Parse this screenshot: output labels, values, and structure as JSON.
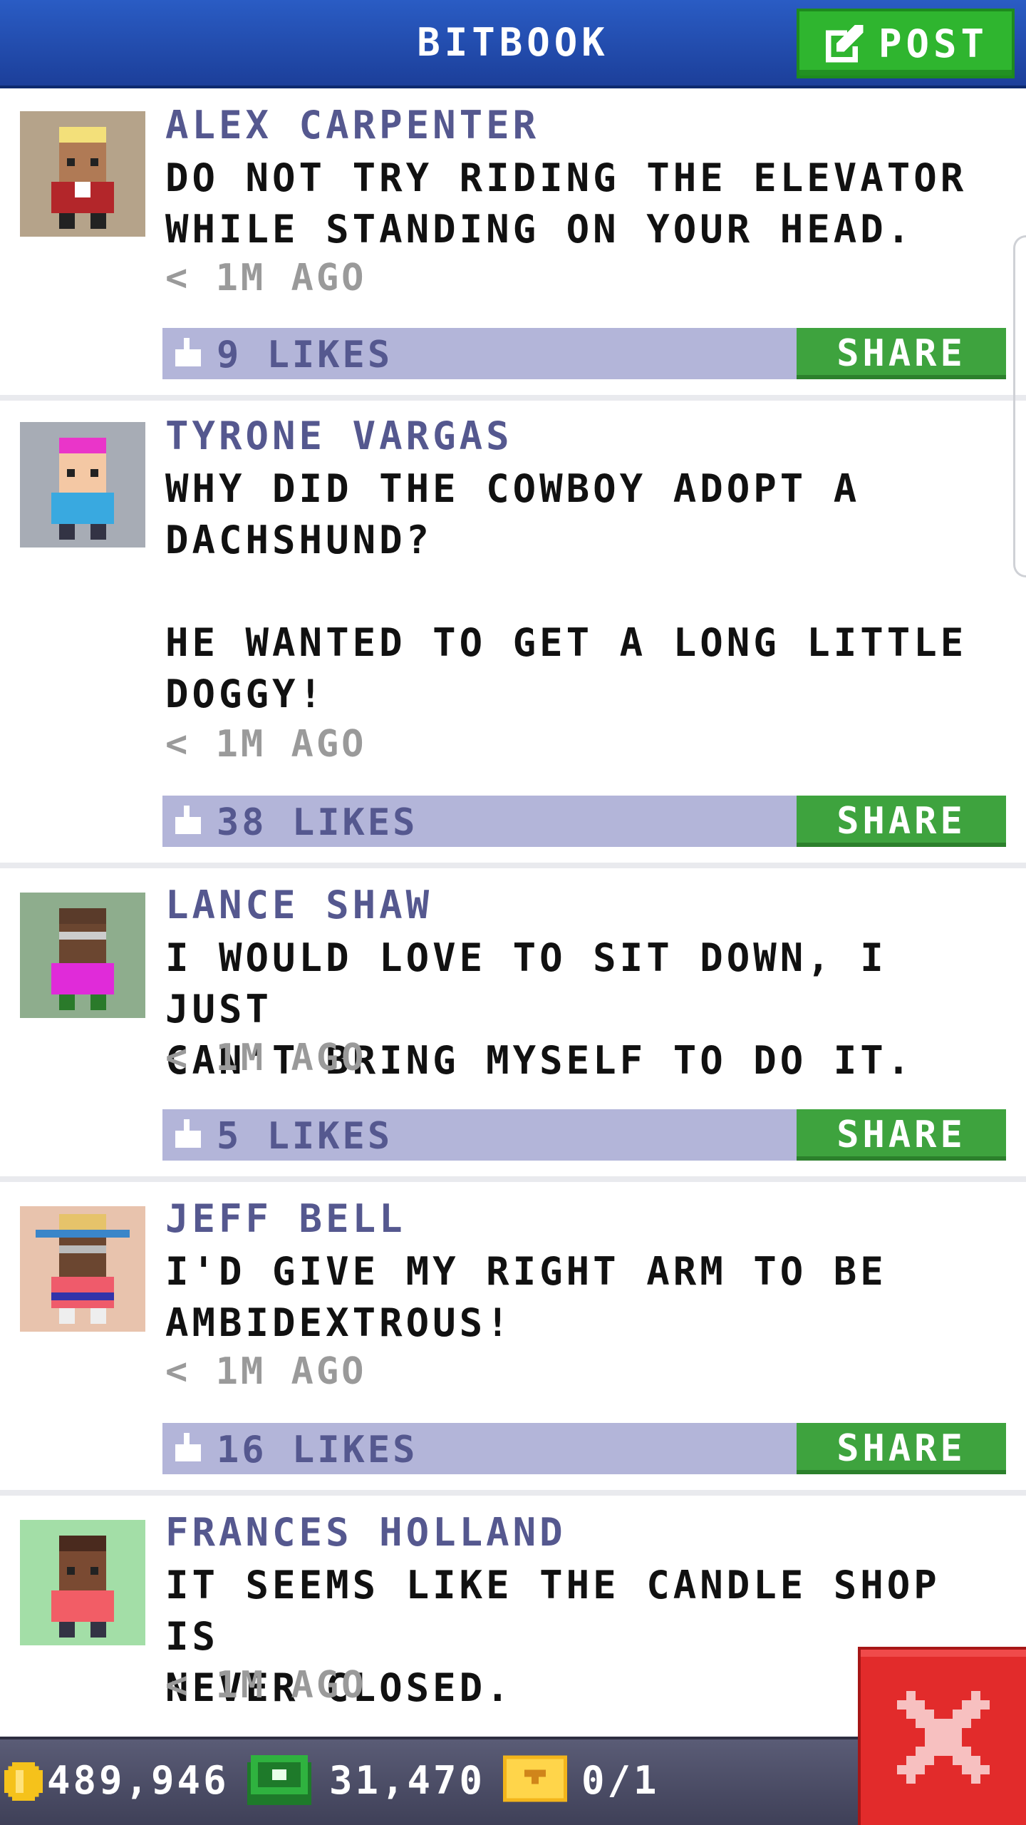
{
  "header": {
    "title": "BITBOOK",
    "post_label": "POST"
  },
  "posts": [
    {
      "author": "ALEX CARPENTER",
      "message": "DO NOT TRY RIDING THE ELEVATOR\nWHILE STANDING ON YOUR HEAD.",
      "time": "< 1M AGO",
      "likes": "9 LIKES",
      "share": "SHARE"
    },
    {
      "author": "TYRONE VARGAS",
      "message": "WHY DID THE COWBOY ADOPT A\nDACHSHUND?\n\nHE WANTED TO GET A LONG LITTLE\nDOGGY!",
      "time": "< 1M AGO",
      "likes": "38 LIKES",
      "share": "SHARE"
    },
    {
      "author": "LANCE SHAW",
      "message": "I WOULD LOVE TO SIT DOWN, I JUST\nCAN'T BRING MYSELF TO DO IT.",
      "time": "< 1M AGO",
      "likes": "5 LIKES",
      "share": "SHARE"
    },
    {
      "author": "JEFF BELL",
      "message": "I'D GIVE MY RIGHT ARM TO BE\nAMBIDEXTROUS!",
      "time": "< 1M AGO",
      "likes": "16 LIKES",
      "share": "SHARE"
    },
    {
      "author": "FRANCES HOLLAND",
      "message": "IT SEEMS LIKE THE CANDLE SHOP IS\nNEVER CLOSED.",
      "time": "< 1M AGO"
    }
  ],
  "status": {
    "coins": "489,946",
    "bux": "31,470",
    "tickets": "0/1"
  },
  "icons": {
    "post": "edit-icon",
    "like": "thumbs-up-icon",
    "coin": "coin-icon",
    "bux": "bux-icon",
    "ticket": "golden-ticket-icon",
    "close": "close-icon"
  },
  "colors": {
    "header": "#1c3f9a",
    "post_button": "#2fb52f",
    "share_button": "#3ea33e",
    "likes_bar": "#b3b5d9",
    "author": "#55588f",
    "close_button": "#e22b2b"
  }
}
